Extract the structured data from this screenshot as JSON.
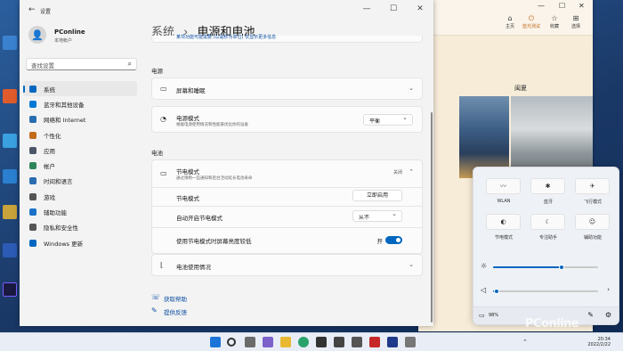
{
  "settings": {
    "app_title": "设置",
    "user_name": "PConline",
    "account_type": "本地帐户",
    "search_placeholder": "查找设置",
    "breadcrumb_parent": "系统",
    "breadcrumb_sep": "›",
    "breadcrumb_current": "电源和电池",
    "nav": [
      {
        "label": "系统",
        "icon": "monitor-icon",
        "color": "#0067c0"
      },
      {
        "label": "蓝牙和其他设备",
        "icon": "bluetooth-icon",
        "color": "#0078d4"
      },
      {
        "label": "网络和 Internet",
        "icon": "wifi-icon",
        "color": "#2b6cb0"
      },
      {
        "label": "个性化",
        "icon": "brush-icon",
        "color": "#c46b1b"
      },
      {
        "label": "应用",
        "icon": "apps-icon",
        "color": "#4a5568"
      },
      {
        "label": "帐户",
        "icon": "person-icon",
        "color": "#2f855a"
      },
      {
        "label": "时间和语言",
        "icon": "globe-clock-icon",
        "color": "#2b6cb0"
      },
      {
        "label": "游戏",
        "icon": "gamepad-icon",
        "color": "#555"
      },
      {
        "label": "辅助功能",
        "icon": "accessibility-icon",
        "color": "#1a73c8"
      },
      {
        "label": "隐私和安全性",
        "icon": "shield-icon",
        "color": "#555"
      },
      {
        "label": "Windows 更新",
        "icon": "update-icon",
        "color": "#0067c0"
      }
    ],
    "top_note": "某项功能可能需要 (以毫秒为单位) 仅显示更多信息",
    "sec_power": "电源",
    "screen_sleep": "屏幕和睡眠",
    "power_mode_title": "电源模式",
    "power_mode_sub": "根据电源使用情况和性能来优化你的设备",
    "power_mode_value": "平衡",
    "sec_battery": "电池",
    "saver_title": "节电模式",
    "saver_sub": "通过限制一些通知和后台活动延长电池寿命",
    "saver_state": "关闭",
    "saver_row": "节电模式",
    "saver_btn": "立即启用",
    "auto_on_label": "自动开启节电模式",
    "auto_on_value": "从不",
    "dim_label": "使用节电模式时屏幕亮度较低",
    "dim_state": "开",
    "battery_usage": "电池使用情况",
    "help_link": "获取帮助",
    "feedback_link": "提供反馈"
  },
  "browser": {
    "buttons": [
      "主页",
      "蓝光测试",
      "收藏",
      "选择"
    ],
    "pic_heading": "闽夏"
  },
  "quick_settings": {
    "tiles": [
      {
        "label": "WLAN",
        "glyph": "〰"
      },
      {
        "label": "蓝牙",
        "glyph": "✱"
      },
      {
        "label": "飞行模式",
        "glyph": "✈"
      },
      {
        "label": "节电模式",
        "glyph": "◐"
      },
      {
        "label": "专注助手",
        "glyph": "☾"
      },
      {
        "label": "辅助功能",
        "glyph": "☺"
      }
    ],
    "brightness_percent": 65,
    "volume_percent": 2,
    "battery_text": "98%"
  },
  "taskbar": {
    "time": "20:34",
    "date": "2022/2/22"
  },
  "watermark": "PConline"
}
